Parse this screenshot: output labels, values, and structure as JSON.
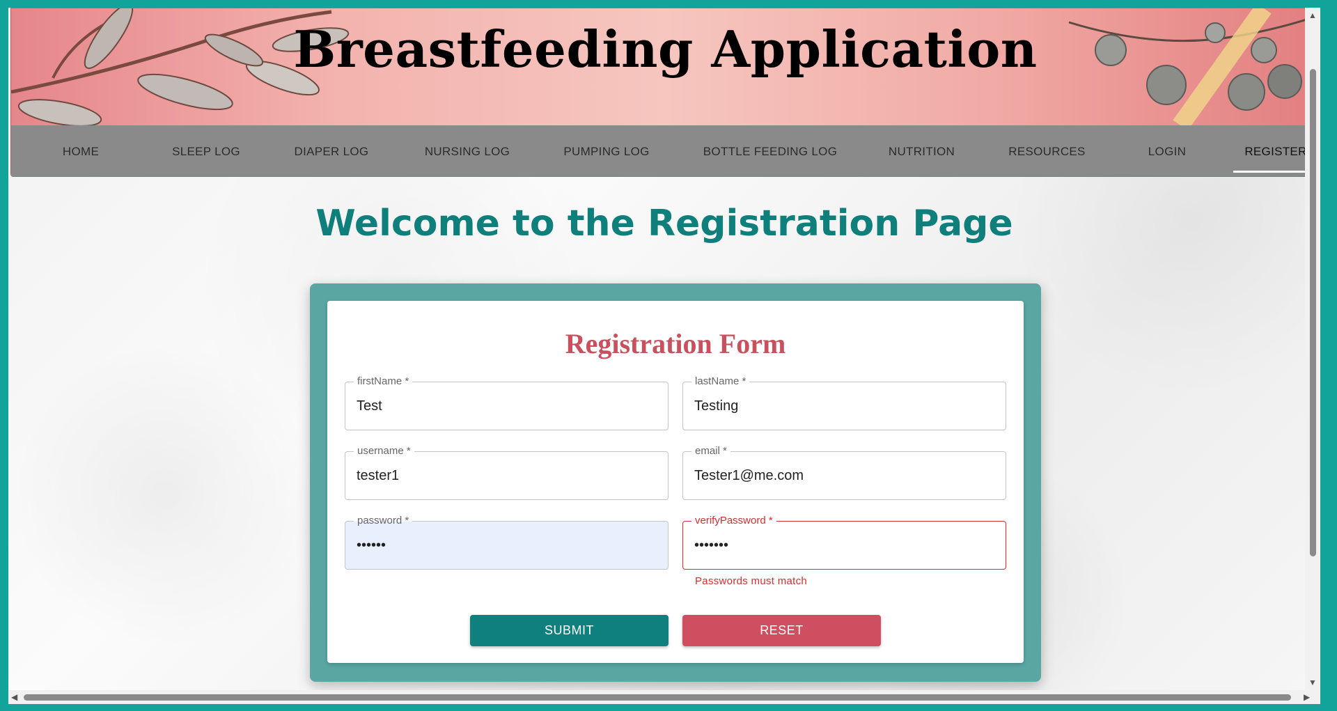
{
  "header": {
    "title": "Breastfeeding Application"
  },
  "nav": {
    "items": [
      {
        "label": "HOME"
      },
      {
        "label": "SLEEP LOG"
      },
      {
        "label": "DIAPER LOG"
      },
      {
        "label": "NURSING LOG"
      },
      {
        "label": "PUMPING LOG"
      },
      {
        "label": "BOTTLE FEEDING LOG"
      },
      {
        "label": "NUTRITION"
      },
      {
        "label": "RESOURCES"
      },
      {
        "label": "LOGIN"
      },
      {
        "label": "REGISTER",
        "active": true
      }
    ]
  },
  "main": {
    "welcome": "Welcome to the Registration Page"
  },
  "form": {
    "title": "Registration Form",
    "fields": {
      "firstName": {
        "label": "firstName *",
        "value": "Test"
      },
      "lastName": {
        "label": "lastName *",
        "value": "Testing"
      },
      "username": {
        "label": "username *",
        "value": "tester1"
      },
      "email": {
        "label": "email *",
        "value": "Tester1@me.com"
      },
      "password": {
        "label": "password *",
        "value": "••••••"
      },
      "verifyPassword": {
        "label": "verifyPassword *",
        "value": "•••••••",
        "error": "Passwords must match"
      }
    },
    "submit_label": "SUBMIT",
    "reset_label": "RESET"
  },
  "colors": {
    "accent": "#0f807d",
    "brand_pink": "#cf4f61",
    "error": "#d32f2f",
    "nav_bg": "#8a8a8a"
  }
}
